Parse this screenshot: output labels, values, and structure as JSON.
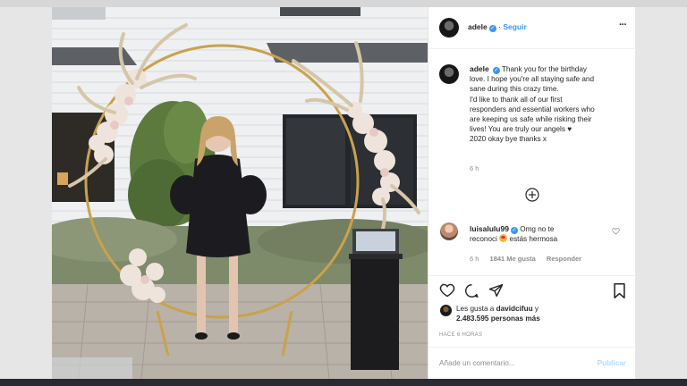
{
  "post": {
    "username": "adele",
    "follow_label": "Seguir",
    "more_label": "···",
    "caption_lines": [
      "Thank you for the birthday",
      "love. I hope you're all staying safe and",
      "sane during this crazy time.",
      "I'd like to thank all of our first",
      "responders and essential workers who",
      "are keeping us safe while risking their",
      "lives! You are truly our angels ♥",
      "2020 okay bye thanks x"
    ],
    "caption_time": "6 h"
  },
  "comment": {
    "username": "luisalulu99",
    "text_part1": "Omg no te",
    "text_part2": "reconoci",
    "text_part3": "estás hermosa",
    "time": "6 h",
    "likes": "1841 Me gusta",
    "reply": "Responder"
  },
  "likes": {
    "prefix": "Les gusta a",
    "first_user": "davidcifuu",
    "connector": "y",
    "count": "2.483.595 personas más"
  },
  "time_ago": "HACE 6 HORAS",
  "comment_input": {
    "placeholder": "Añade un comentario..."
  },
  "publish_label": "Publicar",
  "colors": {
    "link_blue": "#3897f0",
    "publish_disabled": "#b3dbff",
    "muted_text": "#8e8e8e"
  },
  "icons": [
    "more-options-icon",
    "verified-icon",
    "load-more-icon",
    "heart-icon",
    "comment-icon",
    "share-icon",
    "bookmark-icon",
    "emoji-icon"
  ]
}
